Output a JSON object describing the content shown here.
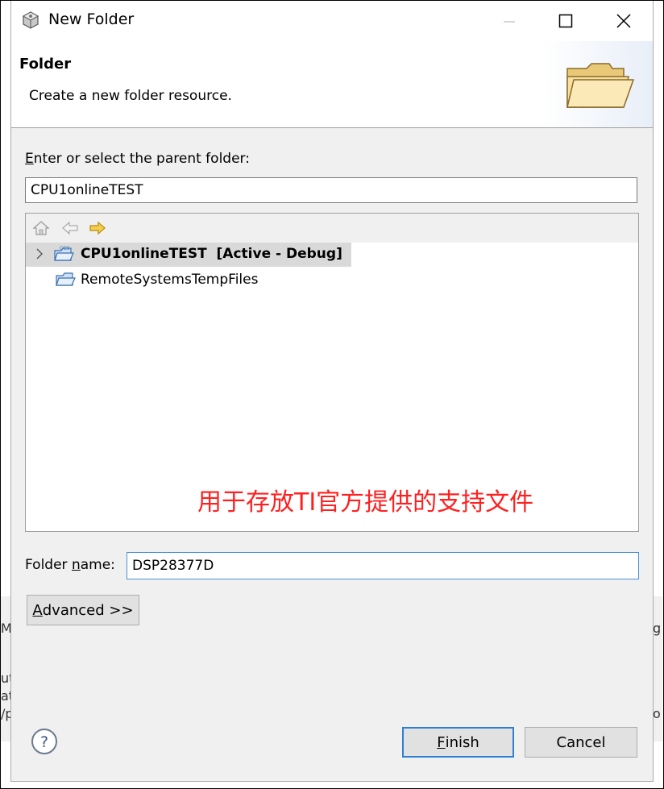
{
  "window": {
    "title": "New Folder"
  },
  "header": {
    "title": "Folder",
    "description": "Create a new folder resource."
  },
  "parent_folder": {
    "label_prefix": "",
    "label_mnemonic": "E",
    "label_rest": "nter or select the parent folder:",
    "value": "CPU1onlineTEST"
  },
  "tree": {
    "items": [
      {
        "name": "CPU1onlineTEST",
        "suffix": "[Active - Debug]",
        "selected": true,
        "expandable": true,
        "icon": "ccs-project-folder-icon"
      },
      {
        "name": "RemoteSystemsTempFiles",
        "suffix": "",
        "selected": false,
        "expandable": false,
        "icon": "project-folder-icon"
      }
    ]
  },
  "annotation": {
    "text": "用于存放TI官方提供的支持文件",
    "color": "#ff2020"
  },
  "folder_name": {
    "label_prefix": "Folder ",
    "label_mnemonic": "n",
    "label_rest": "ame:",
    "value": "DSP28377D"
  },
  "buttons": {
    "advanced_mnemonic": "A",
    "advanced_rest": "dvanced >>",
    "finish_mnemonic": "F",
    "finish_rest": "inish",
    "cancel": "Cancel"
  },
  "colors": {
    "accent": "#2f7fd6",
    "background": "#f0f0f0"
  }
}
